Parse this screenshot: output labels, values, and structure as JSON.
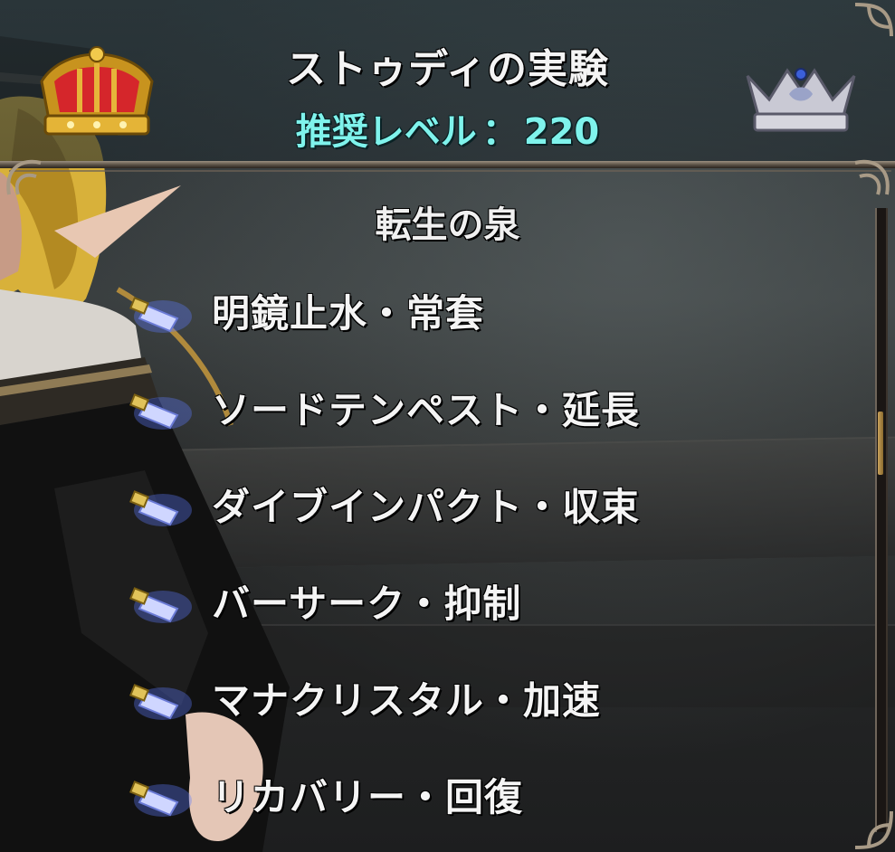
{
  "header": {
    "title": "ストゥディの実験",
    "level_label": "推奨レベル",
    "level_separator": "：",
    "level_value": "220"
  },
  "section": {
    "title": "転生の泉",
    "items": [
      "明鏡止水・常套",
      "ソードテンペスト・延長",
      "ダイブインパクト・収束",
      "バーサーク・抑制",
      "マナクリスタル・加速",
      "リカバリー・回復"
    ]
  },
  "icons": {
    "header_left": "gold-crown-icon",
    "header_right": "silver-crown-icon",
    "list_item": "crystal-usb-icon"
  },
  "colors": {
    "title_text": "#f4f4f4",
    "level_text": "#7ff3ec",
    "scrollbar_thumb": "#c9a25b",
    "frame": "#a89a86"
  }
}
